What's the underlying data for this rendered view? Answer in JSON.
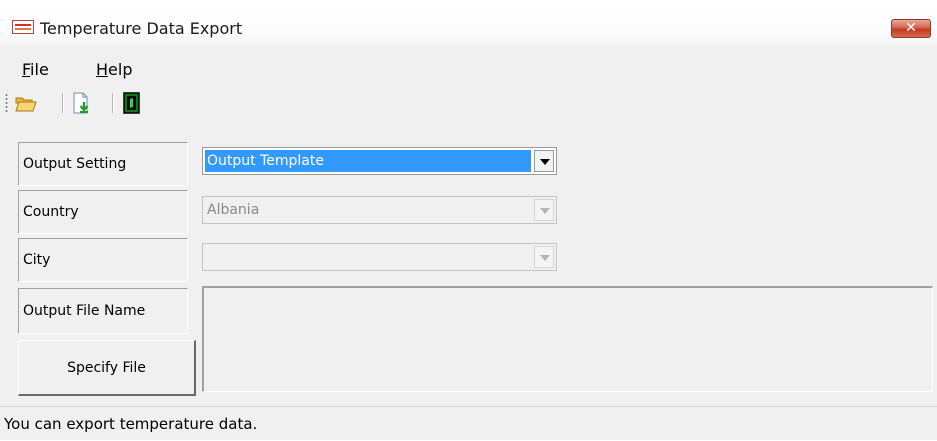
{
  "window": {
    "title": "Temperature Data Export",
    "close_glyph": "✕"
  },
  "menu": {
    "items": [
      {
        "mnemonic": "F",
        "rest": "ile"
      },
      {
        "mnemonic": "H",
        "rest": "elp"
      }
    ]
  },
  "toolbar": {
    "icons": [
      "open-folder-icon",
      "export-file-icon",
      "exit-door-icon"
    ]
  },
  "form": {
    "output_setting": {
      "label": "Output Setting",
      "value": "Output Template"
    },
    "country": {
      "label": "Country",
      "value": "Albania"
    },
    "city": {
      "label": "City",
      "value": ""
    },
    "output_file_name": {
      "label": "Output File Name",
      "value": ""
    },
    "specify_file_button": "Specify File"
  },
  "status": {
    "text": "You can export temperature data."
  },
  "colors": {
    "selection": "#3399ff",
    "window_bg": "#f0f0f0",
    "close_button": "#c23b22"
  }
}
